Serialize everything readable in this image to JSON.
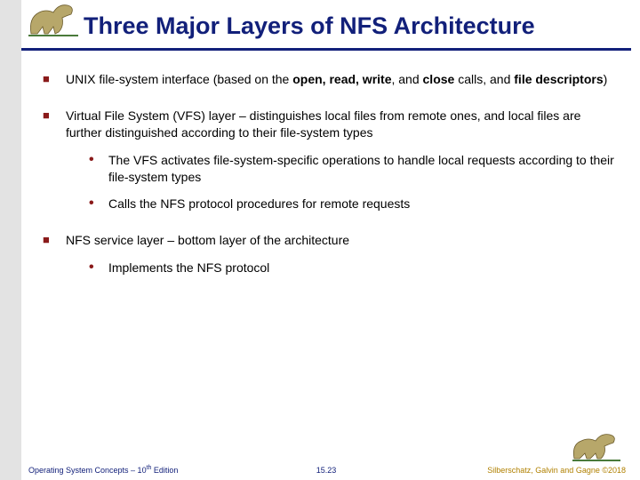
{
  "title": "Three Major Layers of NFS Architecture",
  "bullets": {
    "b1_pre": "UNIX file-system interface (based on the ",
    "b1_bold1": "open, read, write",
    "b1_mid1": ", and ",
    "b1_bold2": "close",
    "b1_mid2": " calls, and ",
    "b1_bold3": "file descriptors",
    "b1_post": ")",
    "b2": "Virtual File System (VFS) layer – distinguishes local files from remote ones, and local files are further distinguished according to their file-system types",
    "b2a": "The VFS activates file-system-specific operations to handle local requests according to their file-system types",
    "b2b": "Calls the NFS protocol procedures for remote requests",
    "b3": "NFS service layer – bottom layer of the architecture",
    "b3a": "Implements the NFS protocol"
  },
  "footer": {
    "left_pre": "Operating System Concepts – 10",
    "left_sup": "th",
    "left_post": " Edition",
    "center": "15.23",
    "right": "Silberschatz, Galvin and Gagne ©2018"
  }
}
